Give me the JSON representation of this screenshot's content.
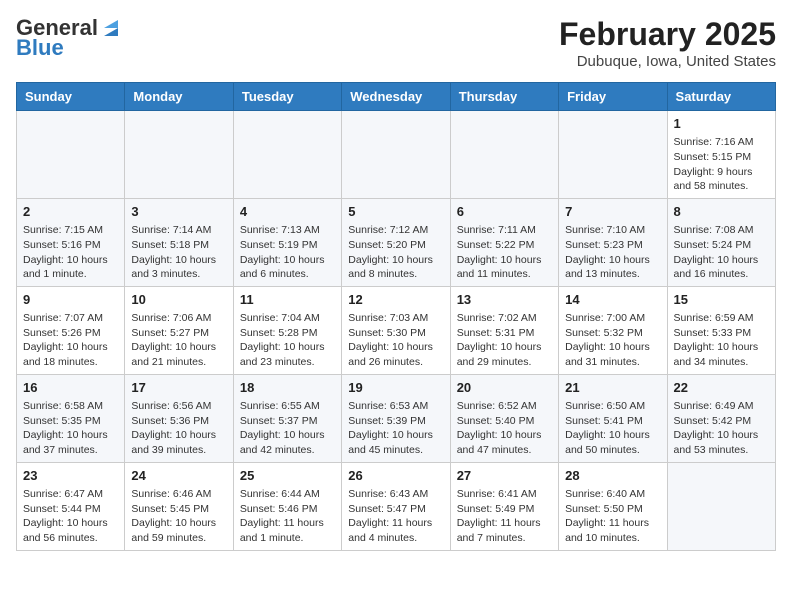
{
  "header": {
    "logo_general": "General",
    "logo_blue": "Blue",
    "title": "February 2025",
    "subtitle": "Dubuque, Iowa, United States"
  },
  "days_of_week": [
    "Sunday",
    "Monday",
    "Tuesday",
    "Wednesday",
    "Thursday",
    "Friday",
    "Saturday"
  ],
  "weeks": [
    [
      {
        "day": "",
        "content": ""
      },
      {
        "day": "",
        "content": ""
      },
      {
        "day": "",
        "content": ""
      },
      {
        "day": "",
        "content": ""
      },
      {
        "day": "",
        "content": ""
      },
      {
        "day": "",
        "content": ""
      },
      {
        "day": "1",
        "content": "Sunrise: 7:16 AM\nSunset: 5:15 PM\nDaylight: 9 hours and 58 minutes."
      }
    ],
    [
      {
        "day": "2",
        "content": "Sunrise: 7:15 AM\nSunset: 5:16 PM\nDaylight: 10 hours and 1 minute."
      },
      {
        "day": "3",
        "content": "Sunrise: 7:14 AM\nSunset: 5:18 PM\nDaylight: 10 hours and 3 minutes."
      },
      {
        "day": "4",
        "content": "Sunrise: 7:13 AM\nSunset: 5:19 PM\nDaylight: 10 hours and 6 minutes."
      },
      {
        "day": "5",
        "content": "Sunrise: 7:12 AM\nSunset: 5:20 PM\nDaylight: 10 hours and 8 minutes."
      },
      {
        "day": "6",
        "content": "Sunrise: 7:11 AM\nSunset: 5:22 PM\nDaylight: 10 hours and 11 minutes."
      },
      {
        "day": "7",
        "content": "Sunrise: 7:10 AM\nSunset: 5:23 PM\nDaylight: 10 hours and 13 minutes."
      },
      {
        "day": "8",
        "content": "Sunrise: 7:08 AM\nSunset: 5:24 PM\nDaylight: 10 hours and 16 minutes."
      }
    ],
    [
      {
        "day": "9",
        "content": "Sunrise: 7:07 AM\nSunset: 5:26 PM\nDaylight: 10 hours and 18 minutes."
      },
      {
        "day": "10",
        "content": "Sunrise: 7:06 AM\nSunset: 5:27 PM\nDaylight: 10 hours and 21 minutes."
      },
      {
        "day": "11",
        "content": "Sunrise: 7:04 AM\nSunset: 5:28 PM\nDaylight: 10 hours and 23 minutes."
      },
      {
        "day": "12",
        "content": "Sunrise: 7:03 AM\nSunset: 5:30 PM\nDaylight: 10 hours and 26 minutes."
      },
      {
        "day": "13",
        "content": "Sunrise: 7:02 AM\nSunset: 5:31 PM\nDaylight: 10 hours and 29 minutes."
      },
      {
        "day": "14",
        "content": "Sunrise: 7:00 AM\nSunset: 5:32 PM\nDaylight: 10 hours and 31 minutes."
      },
      {
        "day": "15",
        "content": "Sunrise: 6:59 AM\nSunset: 5:33 PM\nDaylight: 10 hours and 34 minutes."
      }
    ],
    [
      {
        "day": "16",
        "content": "Sunrise: 6:58 AM\nSunset: 5:35 PM\nDaylight: 10 hours and 37 minutes."
      },
      {
        "day": "17",
        "content": "Sunrise: 6:56 AM\nSunset: 5:36 PM\nDaylight: 10 hours and 39 minutes."
      },
      {
        "day": "18",
        "content": "Sunrise: 6:55 AM\nSunset: 5:37 PM\nDaylight: 10 hours and 42 minutes."
      },
      {
        "day": "19",
        "content": "Sunrise: 6:53 AM\nSunset: 5:39 PM\nDaylight: 10 hours and 45 minutes."
      },
      {
        "day": "20",
        "content": "Sunrise: 6:52 AM\nSunset: 5:40 PM\nDaylight: 10 hours and 47 minutes."
      },
      {
        "day": "21",
        "content": "Sunrise: 6:50 AM\nSunset: 5:41 PM\nDaylight: 10 hours and 50 minutes."
      },
      {
        "day": "22",
        "content": "Sunrise: 6:49 AM\nSunset: 5:42 PM\nDaylight: 10 hours and 53 minutes."
      }
    ],
    [
      {
        "day": "23",
        "content": "Sunrise: 6:47 AM\nSunset: 5:44 PM\nDaylight: 10 hours and 56 minutes."
      },
      {
        "day": "24",
        "content": "Sunrise: 6:46 AM\nSunset: 5:45 PM\nDaylight: 10 hours and 59 minutes."
      },
      {
        "day": "25",
        "content": "Sunrise: 6:44 AM\nSunset: 5:46 PM\nDaylight: 11 hours and 1 minute."
      },
      {
        "day": "26",
        "content": "Sunrise: 6:43 AM\nSunset: 5:47 PM\nDaylight: 11 hours and 4 minutes."
      },
      {
        "day": "27",
        "content": "Sunrise: 6:41 AM\nSunset: 5:49 PM\nDaylight: 11 hours and 7 minutes."
      },
      {
        "day": "28",
        "content": "Sunrise: 6:40 AM\nSunset: 5:50 PM\nDaylight: 11 hours and 10 minutes."
      },
      {
        "day": "",
        "content": ""
      }
    ]
  ]
}
